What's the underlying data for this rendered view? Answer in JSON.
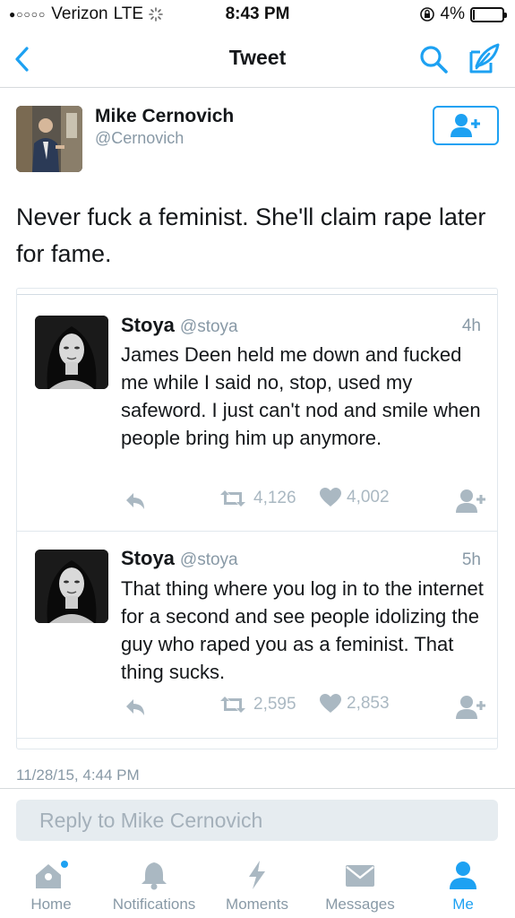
{
  "status_bar": {
    "carrier": "Verizon",
    "network": "LTE",
    "time": "8:43 PM",
    "battery_percent": "4%",
    "battery_level": 0.04
  },
  "nav": {
    "title": "Tweet",
    "back_icon": "chevron-left-icon",
    "search_icon": "search-icon",
    "compose_icon": "compose-icon"
  },
  "tweet": {
    "author_name": "Mike Cernovich",
    "author_handle": "@Cernovich",
    "text": "Never fuck a feminist. She'll claim rape later for fame.",
    "timestamp": "11/28/15, 4:44 PM"
  },
  "quoted_tweets": [
    {
      "name": "Stoya",
      "handle": "@stoya",
      "time": "4h",
      "text": "James Deen held me down and fucked me while I said no, stop, used my safeword. I just can't nod and smile when people bring him up anymore.",
      "retweets": "4,126",
      "likes": "4,002"
    },
    {
      "name": "Stoya",
      "handle": "@stoya",
      "time": "5h",
      "text": "That thing where you log in to the internet for a second and see people idolizing the guy who raped you as a feminist. That thing sucks.",
      "retweets": "2,595",
      "likes": "2,853"
    }
  ],
  "reply": {
    "placeholder": "Reply to Mike Cernovich"
  },
  "tabs": [
    {
      "label": "Home",
      "icon": "home-icon"
    },
    {
      "label": "Notifications",
      "icon": "bell-icon"
    },
    {
      "label": "Moments",
      "icon": "lightning-icon"
    },
    {
      "label": "Messages",
      "icon": "envelope-icon"
    },
    {
      "label": "Me",
      "icon": "person-icon"
    }
  ],
  "colors": {
    "accent": "#1da1f2",
    "muted": "#8899a6",
    "icon_muted": "#aab8c2"
  }
}
